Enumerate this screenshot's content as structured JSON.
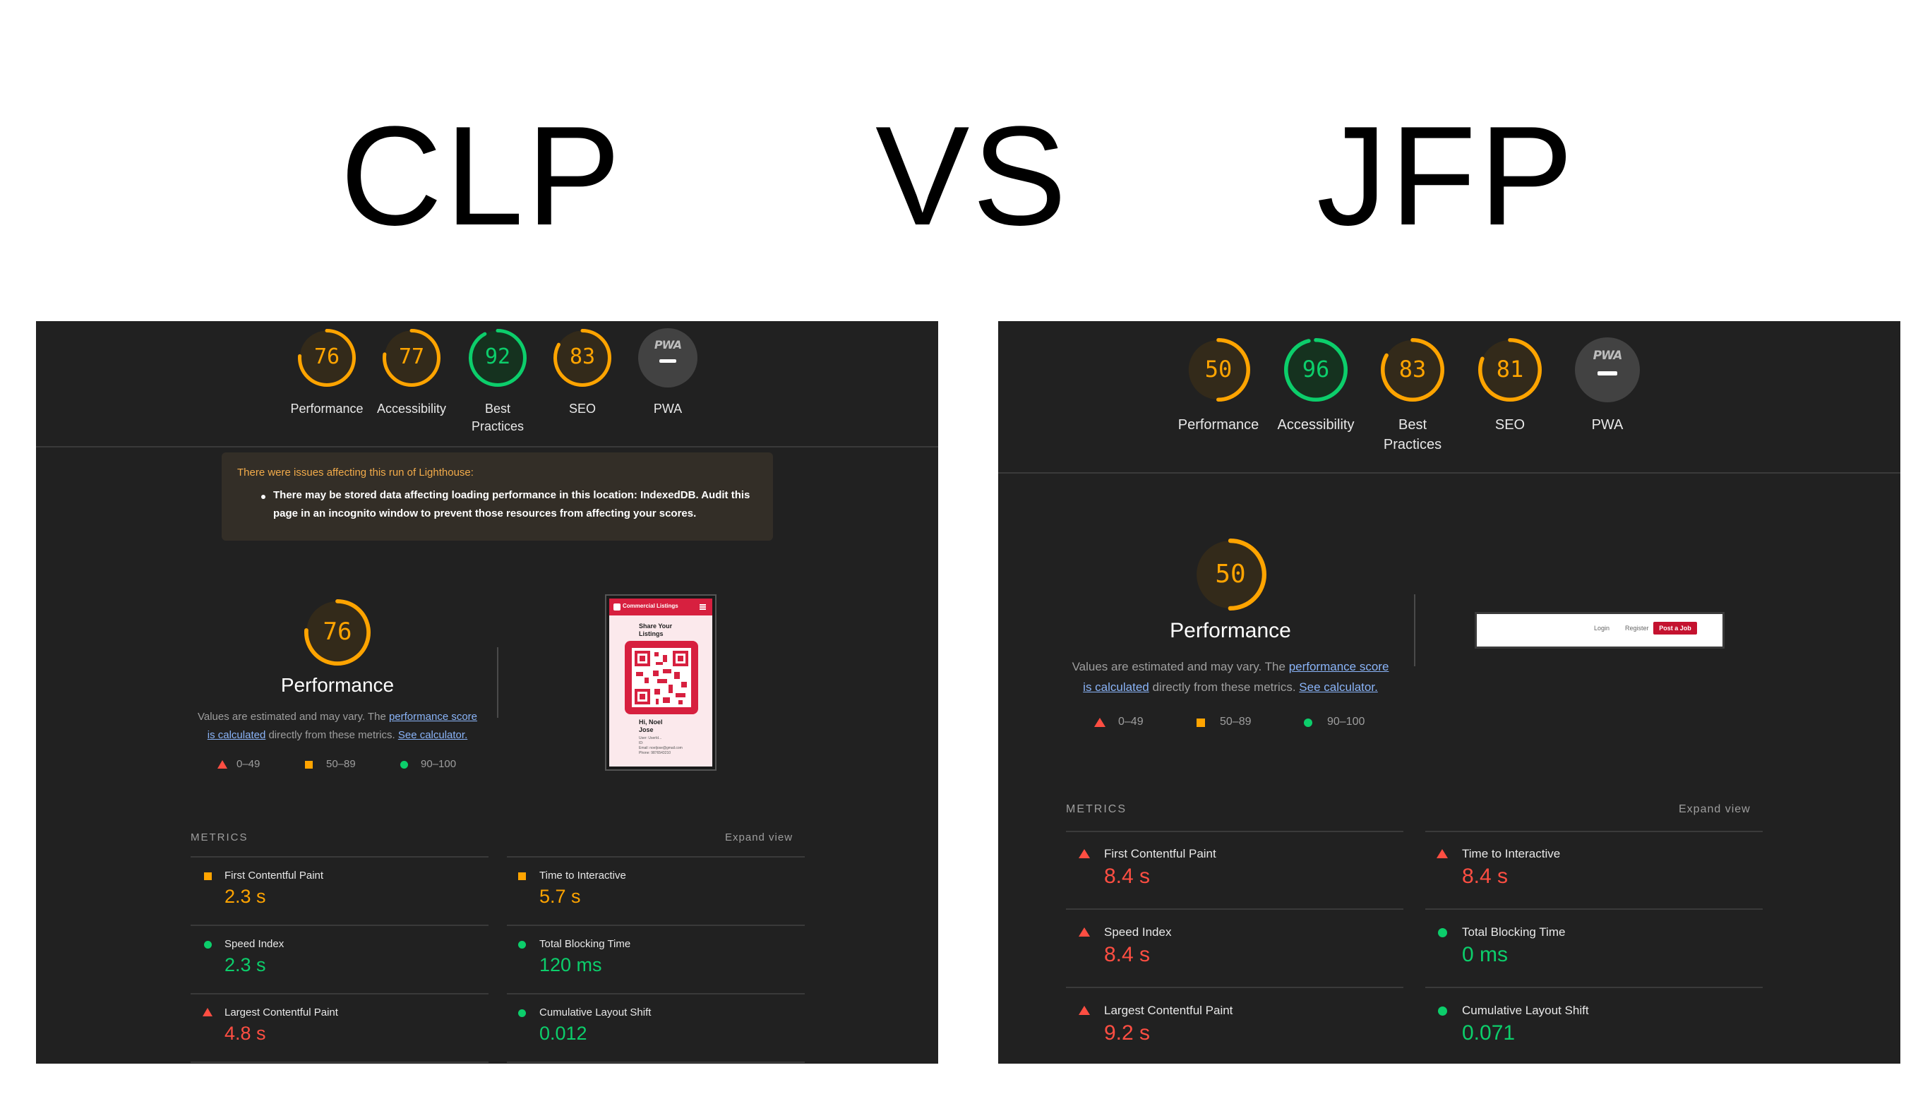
{
  "headings": {
    "left": "CLP",
    "middle": "VS",
    "right": "JFP"
  },
  "colors": {
    "fail": "#ff4e42",
    "average": "#ffa400",
    "pass": "#0cce6b",
    "panel_bg": "#212121"
  },
  "left": {
    "scores": [
      {
        "value": 76,
        "label": "Performance"
      },
      {
        "value": 77,
        "label": "Accessibility"
      },
      {
        "value": 92,
        "label": "Best Practices",
        "label_line1": "Best",
        "label_line2": "Practices"
      },
      {
        "value": 83,
        "label": "SEO"
      }
    ],
    "pwa": {
      "badge": "PWA",
      "label": "PWA"
    },
    "warning": {
      "title": "There were issues affecting this run of Lighthouse:",
      "line1": "There may be stored data affecting loading performance in this location: IndexedDB. Audit this",
      "line2": "page in an incognito window to prevent those resources from affecting your scores."
    },
    "performance": {
      "value": 76,
      "label": "Performance"
    },
    "description": {
      "pre": "Values are estimated and may vary. The ",
      "link1_a": "performance score",
      "link1_b": "is calculated",
      "mid": " directly from these metrics. ",
      "link2": "See calculator."
    },
    "legend": [
      "0–49",
      "50–89",
      "90–100"
    ],
    "screenshot": {
      "brand": "Commercial Listings",
      "heading_line1": "Share Your",
      "heading_line2": "Listings",
      "user_line1": "Hi, Noel",
      "user_line2": "Jose",
      "info": [
        "User: UserId...",
        "ID:",
        "Email: noeljose@gmail.com",
        "Phone: 9876543210"
      ]
    },
    "metrics_title": "METRICS",
    "expand": "Expand view",
    "metrics": [
      {
        "name": "First Contentful Paint",
        "value": "2.3 s",
        "rating": "average"
      },
      {
        "name": "Time to Interactive",
        "value": "5.7 s",
        "rating": "average"
      },
      {
        "name": "Speed Index",
        "value": "2.3 s",
        "rating": "pass"
      },
      {
        "name": "Total Blocking Time",
        "value": "120 ms",
        "rating": "pass"
      },
      {
        "name": "Largest Contentful Paint",
        "value": "4.8 s",
        "rating": "fail"
      },
      {
        "name": "Cumulative Layout Shift",
        "value": "0.012",
        "rating": "pass"
      }
    ]
  },
  "right": {
    "scores": [
      {
        "value": 50,
        "label": "Performance"
      },
      {
        "value": 96,
        "label": "Accessibility"
      },
      {
        "value": 83,
        "label": "Best Practices",
        "label_line1": "Best",
        "label_line2": "Practices"
      },
      {
        "value": 81,
        "label": "SEO"
      }
    ],
    "pwa": {
      "badge": "PWA",
      "label": "PWA"
    },
    "performance": {
      "value": 50,
      "label": "Performance"
    },
    "description": {
      "pre": "Values are estimated and may vary. The ",
      "link1_a": "performance score",
      "link1_b": "is calculated",
      "mid": " directly from these metrics. ",
      "link2": "See calculator."
    },
    "legend": [
      "0–49",
      "50–89",
      "90–100"
    ],
    "screenshot": {
      "login": "Login",
      "register": "Register",
      "post": "Post a Job"
    },
    "metrics_title": "METRICS",
    "expand": "Expand view",
    "metrics": [
      {
        "name": "First Contentful Paint",
        "value": "8.4 s",
        "rating": "fail"
      },
      {
        "name": "Time to Interactive",
        "value": "8.4 s",
        "rating": "fail"
      },
      {
        "name": "Speed Index",
        "value": "8.4 s",
        "rating": "fail"
      },
      {
        "name": "Total Blocking Time",
        "value": "0 ms",
        "rating": "pass"
      },
      {
        "name": "Largest Contentful Paint",
        "value": "9.2 s",
        "rating": "fail"
      },
      {
        "name": "Cumulative Layout Shift",
        "value": "0.071",
        "rating": "pass"
      }
    ]
  }
}
